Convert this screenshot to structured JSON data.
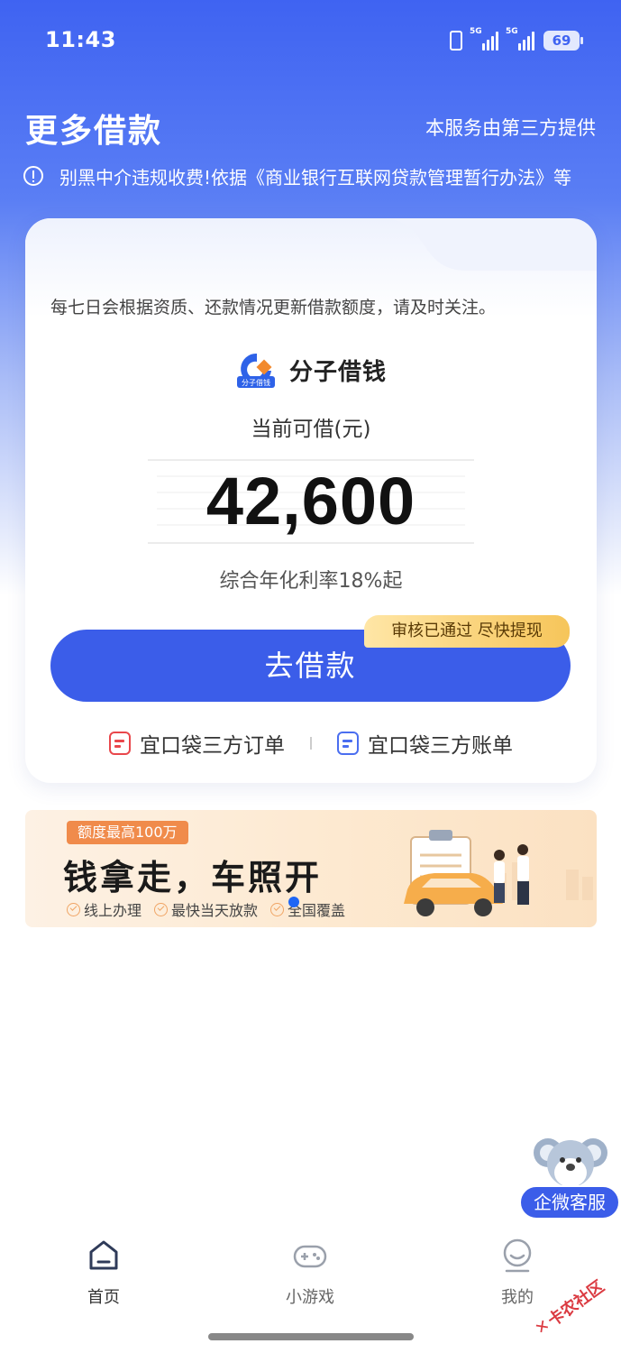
{
  "status_bar": {
    "time": "11:43",
    "battery": "69",
    "network_1": "5G",
    "network_2": "5G"
  },
  "header": {
    "title": "更多借款",
    "provider_note": "本服务由第三方提供",
    "notice": "别黑中介违规收费!依据《商业银行互联网贷款管理暂行办法》等"
  },
  "loan_card": {
    "hint": "每七日会根据资质、还款情况更新借款额度，请及时关注。",
    "brand_name": "分子借钱",
    "brand_logo_text": "分子借钱",
    "amount_label": "当前可借(元)",
    "amount": "42,600",
    "rate": "综合年化利率18%起",
    "borrow_button": "去借款",
    "badge": "审核已通过 尽快提现",
    "link_orders": "宜口袋三方订单",
    "link_bills": "宜口袋三方账单"
  },
  "banner": {
    "tag": "额度最高100万",
    "headline": "钱拿走，车照开",
    "features": [
      "线上办理",
      "最快当天放款",
      "全国覆盖"
    ]
  },
  "customer_service": {
    "label": "企微客服"
  },
  "bottom_nav": {
    "items": [
      {
        "label": "首页",
        "icon": "home-icon",
        "active": true
      },
      {
        "label": "小游戏",
        "icon": "gamepad-icon",
        "active": false
      },
      {
        "label": "我的",
        "icon": "profile-icon",
        "active": false
      }
    ]
  },
  "watermark": "卡农社区",
  "colors": {
    "primary": "#3b5de9",
    "badge_gold": "#f6c55a",
    "banner_tag": "#f08b4b"
  }
}
